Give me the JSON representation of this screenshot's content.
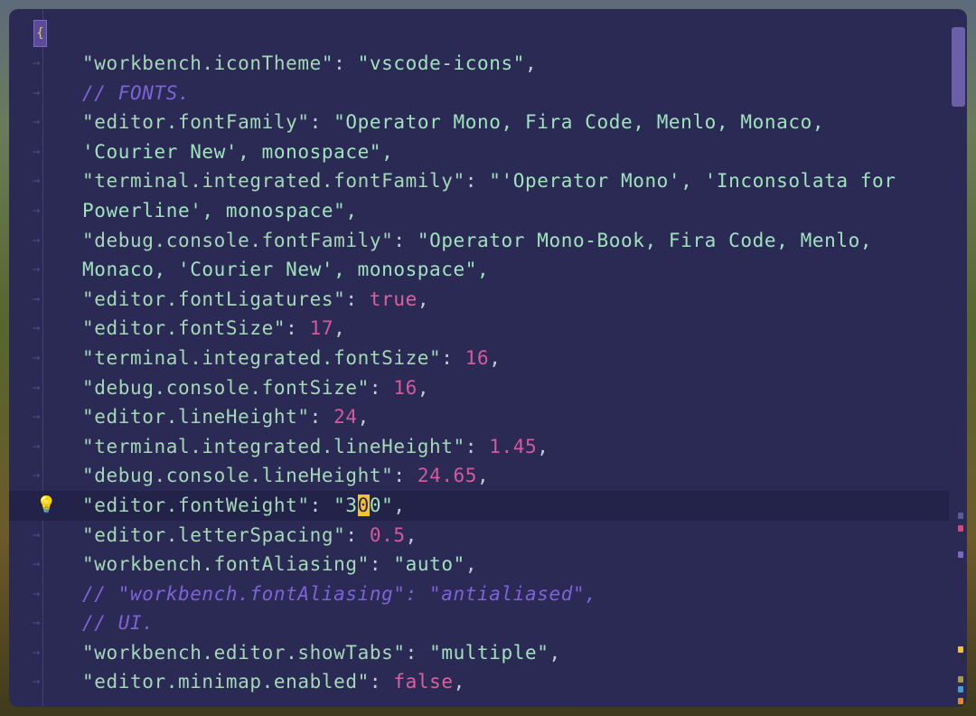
{
  "colors": {
    "background": "#2b2a55",
    "key": "#a3d9b6",
    "string": "#9fe3bd",
    "number": "#d35a9b",
    "comment": "#7d63d9",
    "cursor": "#f2c430"
  },
  "icons": {
    "fold": "fold-icon",
    "indent": "indent-arrow-icon",
    "lightbulb": "lightbulb-icon"
  },
  "gutter": {
    "fold_glyph": "{",
    "arrow": "→",
    "bulb": "💡"
  },
  "lines": [
    {
      "k": "\"workbench.iconTheme\"",
      "v": "\"vscode-icons\"",
      "t": "str",
      "end": ","
    },
    {
      "c": "// FONTS."
    },
    {
      "k": "\"editor.fontFamily\"",
      "v": "\"Operator Mono, Fira Code, Menlo, Monaco,",
      "t": "str",
      "end": ""
    },
    {
      "raw": "'Courier New', monospace\","
    },
    {
      "k": "\"terminal.integrated.fontFamily\"",
      "v": "\"'Operator Mono', 'Inconsolata for",
      "t": "str",
      "end": ""
    },
    {
      "raw": "Powerline', monospace\","
    },
    {
      "k": "\"debug.console.fontFamily\"",
      "v": "\"Operator Mono-Book, Fira Code, Menlo,",
      "t": "str",
      "end": ""
    },
    {
      "raw": "Monaco, 'Courier New', monospace\","
    },
    {
      "k": "\"editor.fontLigatures\"",
      "v": "true",
      "t": "bool",
      "end": ","
    },
    {
      "k": "\"editor.fontSize\"",
      "v": "17",
      "t": "num",
      "end": ","
    },
    {
      "k": "\"terminal.integrated.fontSize\"",
      "v": "16",
      "t": "num",
      "end": ","
    },
    {
      "k": "\"debug.console.fontSize\"",
      "v": "16",
      "t": "num",
      "end": ","
    },
    {
      "k": "\"editor.lineHeight\"",
      "v": "24",
      "t": "num",
      "end": ","
    },
    {
      "k": "\"terminal.integrated.lineHeight\"",
      "v": "1.45",
      "t": "num",
      "end": ","
    },
    {
      "k": "\"debug.console.lineHeight\"",
      "v": "24.65",
      "t": "num",
      "end": ","
    },
    {
      "k": "\"editor.fontWeight\"",
      "v": "\"300\"",
      "t": "str",
      "end": ",",
      "active": true
    },
    {
      "k": "\"editor.letterSpacing\"",
      "v": "0.5",
      "t": "num",
      "end": ","
    },
    {
      "k": "\"workbench.fontAliasing\"",
      "v": "\"auto\"",
      "t": "str",
      "end": ","
    },
    {
      "c": "// \"workbench.fontAliasing\": \"antialiased\","
    },
    {
      "c": "// UI."
    },
    {
      "k": "\"workbench.editor.showTabs\"",
      "v": "\"multiple\"",
      "t": "str",
      "end": ","
    },
    {
      "k": "\"editor.minimap.enabled\"",
      "v": "false",
      "t": "bool",
      "end": ","
    }
  ],
  "overview_marks": [
    {
      "color": "#5d5a9a",
      "pos": 0.72
    },
    {
      "color": "#d04a7a",
      "pos": 0.738
    },
    {
      "color": "#7a6ac4",
      "pos": 0.776
    },
    {
      "color": "#f2c430",
      "pos": 0.914
    },
    {
      "color": "#a89a4a",
      "pos": 0.958
    },
    {
      "color": "#4a9ad0",
      "pos": 0.972
    },
    {
      "color": "#e08a30",
      "pos": 0.99
    }
  ]
}
